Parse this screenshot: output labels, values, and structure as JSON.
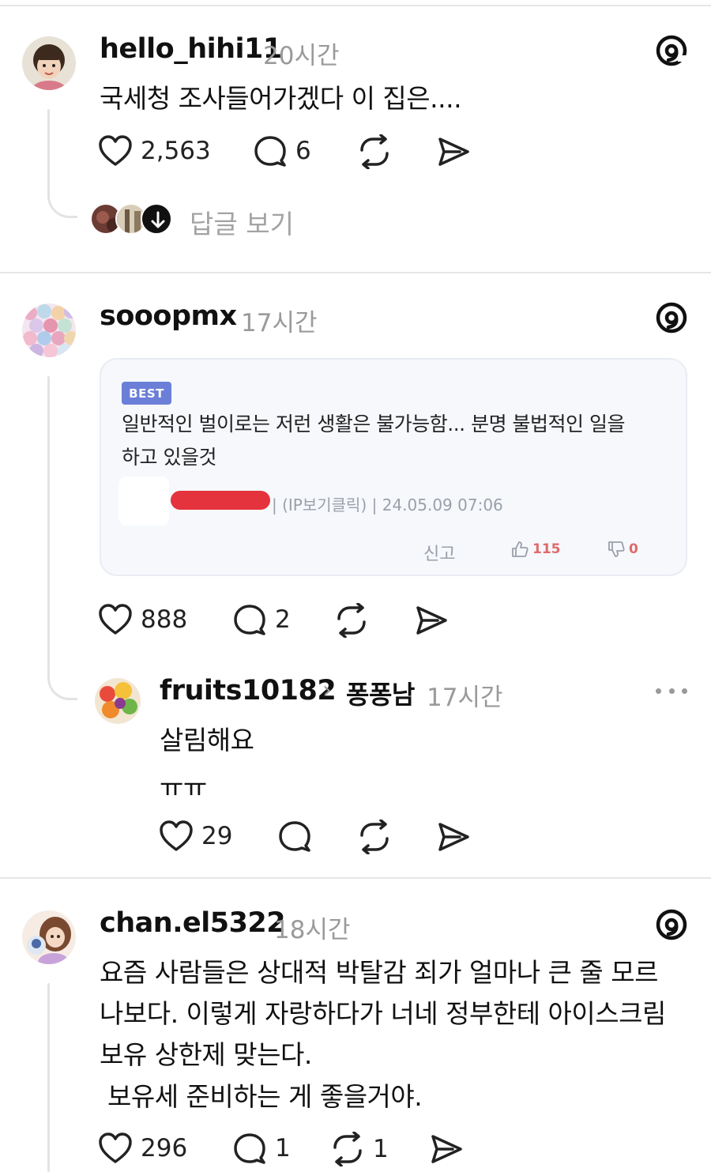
{
  "post1": {
    "username": "hello_hihi11",
    "time": "20시간",
    "text": "국세청 조사들어가겠다 이 집은....",
    "likes": "2,563",
    "comments": "6",
    "view_replies": "답글 보기"
  },
  "post2": {
    "username": "sooopmx",
    "time": "17시간",
    "card": {
      "badge": "BEST",
      "line1": "일반적인 벌이로는 저런 생활은 불가능함... 분명 불법적인 일을",
      "line2": "하고 있을것",
      "meta": "| (IP보기클릭) | 24.05.09 07:06",
      "report": "신고",
      "up_count": "115",
      "down_count": "0"
    },
    "likes": "888",
    "comments": "2",
    "reply": {
      "username": "fruits10182",
      "reply_to": "퐁퐁남",
      "time": "17시간",
      "line1": "살림해요",
      "line2": "ㅠㅠ",
      "likes": "29"
    }
  },
  "post3": {
    "username": "chan.el5322",
    "time": "18시간",
    "lines": [
      "요즘 사람들은 상대적 박탈감 죄가 얼마나 큰 줄 모르",
      "나보다. 이렇게 자랑하다가 너네 정부한테 아이스크림",
      "보유 상한제 맞는다.",
      " 보유세 준비하는 게 좋을거야."
    ],
    "likes": "296",
    "comments": "1",
    "reposts": "1"
  },
  "icons": {
    "like": "heart-icon",
    "comment": "comment-bubble-icon",
    "repost": "repost-icon",
    "share": "send-icon",
    "logo": "threads-logo-icon"
  }
}
